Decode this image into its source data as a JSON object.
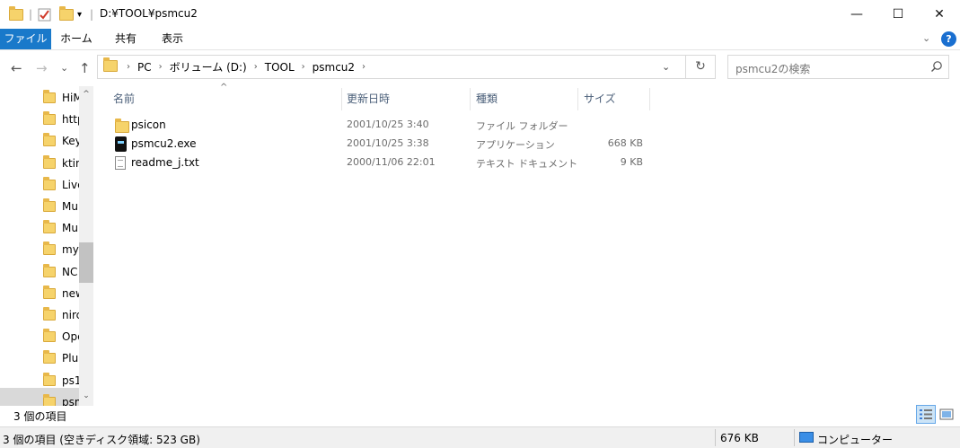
{
  "window": {
    "title": "D:¥TOOL¥psmcu2",
    "minimize_glyph": "—",
    "maximize_glyph": "☐",
    "close_glyph": "✕"
  },
  "ribbon": {
    "tabs": [
      {
        "label": "ファイル",
        "active": true
      },
      {
        "label": "ホーム"
      },
      {
        "label": "共有"
      },
      {
        "label": "表示"
      }
    ],
    "expand_glyph": "⌄",
    "help_glyph": "?"
  },
  "nav": {
    "back_glyph": "←",
    "forward_glyph": "→",
    "recent_glyph": "⌄",
    "up_glyph": "↑",
    "breadcrumbs": [
      "PC",
      "ボリューム (D:)",
      "TOOL",
      "psmcu2"
    ],
    "breadcrumb_sep": "›",
    "dropdown_glyph": "⌄",
    "refresh_glyph": "↻"
  },
  "search": {
    "placeholder": "psmcu2の検索"
  },
  "tree": {
    "items": [
      {
        "label": "HiM"
      },
      {
        "label": "http"
      },
      {
        "label": "Key"
      },
      {
        "label": "ktin"
      },
      {
        "label": "Live"
      },
      {
        "label": "Mu"
      },
      {
        "label": "Mu"
      },
      {
        "label": "my"
      },
      {
        "label": "NC"
      },
      {
        "label": "new"
      },
      {
        "label": "nirc"
      },
      {
        "label": "Ope"
      },
      {
        "label": "Plu"
      },
      {
        "label": "ps1"
      },
      {
        "label": "psm",
        "selected": true
      }
    ],
    "scroll_up_glyph": "^",
    "scroll_down_glyph": "⌄"
  },
  "columns": {
    "name": "名前",
    "modified": "更新日時",
    "type": "種類",
    "size": "サイズ",
    "sort_glyph": "^"
  },
  "files": [
    {
      "name": "psicon",
      "modified": "2001/10/25 3:40",
      "type": "ファイル フォルダー",
      "size": "",
      "icon": "folder-icon"
    },
    {
      "name": "psmcu2.exe",
      "modified": "2001/10/25 3:38",
      "type": "アプリケーション",
      "size": "668 KB",
      "icon": "executable-icon"
    },
    {
      "name": "readme_j.txt",
      "modified": "2000/11/06 22:01",
      "type": "テキスト ドキュメント",
      "size": "9 KB",
      "icon": "text-file-icon"
    }
  ],
  "status": {
    "item_count": "3 個の項目",
    "bottom_left": "3 個の項目 (空きディスク領域: 523 GB)",
    "size_total": "676 KB",
    "location": "コンピューター"
  }
}
